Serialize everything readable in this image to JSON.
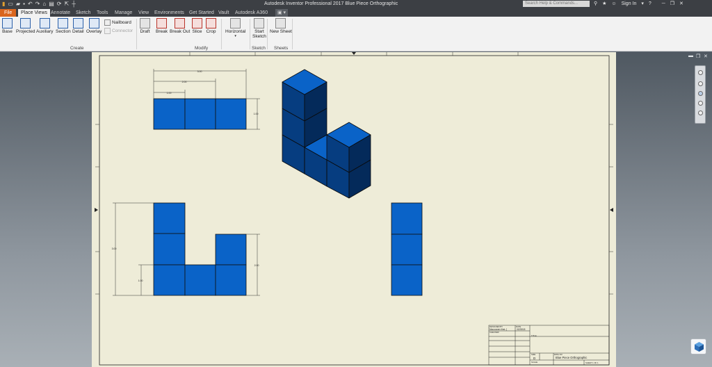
{
  "app": {
    "title": "Autodesk Inventor Professional 2017   Blue Piece Orthographic",
    "search_placeholder": "Search Help & Commands...",
    "sign_in": "Sign In"
  },
  "tabs": [
    "File",
    "Place Views",
    "Annotate",
    "Sketch",
    "Tools",
    "Manage",
    "View",
    "Environments",
    "Get Started",
    "Vault",
    "Autodesk A360"
  ],
  "ribbon": {
    "create": {
      "label": "Create",
      "buttons": [
        "Base",
        "Projected",
        "Auxiliary",
        "Section",
        "Detail",
        "Overlay"
      ],
      "nailboard": "Nailboard",
      "connector": "Connector"
    },
    "modify": {
      "label": "Modify",
      "buttons": [
        "Draft",
        "Break",
        "Break Out",
        "Slice",
        "Crop",
        "Horizontal"
      ]
    },
    "sketch": {
      "label": "Sketch",
      "start_line1": "Start",
      "start_line2": "Sketch"
    },
    "sheets": {
      "label": "Sheets",
      "new_sheet": "New Sheet"
    }
  },
  "drawing": {
    "top_view_dims": [
      "3.00",
      "2.00",
      "1.00",
      "1.00"
    ],
    "front_view_dims": [
      "3.00",
      "2.00",
      "1.00"
    ]
  },
  "title_block": {
    "designed_by": "DESIGNED BY",
    "date": "DATE",
    "drawn_by": "Maccowen<first..]",
    "drawn_date": "02/28/18",
    "checked": "CHECKED",
    "title_label": "TITLE",
    "size_label": "SIZE",
    "size": "D",
    "dwg_no_label": "DWG NO",
    "dwg_no": "Blue Piece Orthographic",
    "scale_label": "SCALE",
    "sheet": "SHEET 1 OF 1"
  },
  "colors": {
    "ribbon_bg": "#f2f2f2",
    "titlebar_bg": "#3c3f44",
    "file_tab": "#d9651e",
    "sheet_bg": "#eeecd8",
    "cube_face": "#0a63c8",
    "cube_side": "#063d80",
    "cube_dark": "#042a5a"
  }
}
